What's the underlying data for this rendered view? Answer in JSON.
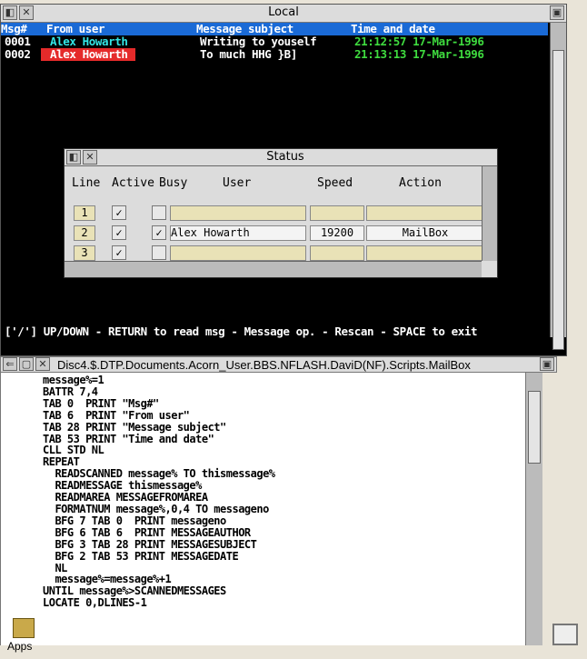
{
  "local": {
    "title": "Local",
    "headers": {
      "num": "Msg#",
      "user": "From user",
      "subject": "Message subject",
      "date": "Time and date"
    },
    "rows": [
      {
        "num": "0001",
        "user": "Alex Howarth",
        "subject": "Writing to youself",
        "date": "21:12:57 17-Mar-1996"
      },
      {
        "num": "0002",
        "user": "Alex Howarth",
        "subject": "To much HHG }B]",
        "date": "21:13:13 17-Mar-1996"
      }
    ],
    "status_line": "['/'] UP/DOWN - RETURN to read msg - Message op. - Rescan - SPACE to exit"
  },
  "status_dialog": {
    "title": "Status",
    "columns": {
      "line": "Line",
      "active": "Active",
      "busy": "Busy",
      "user": "User",
      "speed": "Speed",
      "action": "Action"
    },
    "rows": [
      {
        "line": "1",
        "active": "✓",
        "busy": "",
        "user": "",
        "speed": "",
        "action": ""
      },
      {
        "line": "2",
        "active": "✓",
        "busy": "✓",
        "user": "Alex Howarth",
        "speed": "19200",
        "action": "MailBox"
      },
      {
        "line": "3",
        "active": "✓",
        "busy": "",
        "user": "",
        "speed": "",
        "action": ""
      }
    ]
  },
  "editor": {
    "title": "Disc4.$.DTP.Documents.Acorn_User.BBS.NFLASH.DaviD(NF).Scripts.MailBox",
    "lines": [
      "message%=1",
      "BATTR 7,4",
      "TAB 0  PRINT \"Msg#\"",
      "TAB 6  PRINT \"From user\"",
      "TAB 28 PRINT \"Message subject\"",
      "TAB 53 PRINT \"Time and date\"",
      "CLL STD NL",
      "REPEAT",
      "  READSCANNED message% TO thismessage%",
      "  READMESSAGE thismessage%",
      "  READMAREA MESSAGEFROMAREA",
      "  FORMATNUM message%,0,4 TO messageno",
      "  BFG 7 TAB 0  PRINT messageno",
      "  BFG 6 TAB 6  PRINT MESSAGEAUTHOR",
      "  BFG 3 TAB 28 PRINT MESSAGESUBJECT",
      "  BFG 2 TAB 53 PRINT MESSAGEDATE",
      "  NL",
      "  message%=message%+1",
      "UNTIL message%>SCANNEDMESSAGES",
      "LOCATE 0,DLINES-1"
    ]
  },
  "apps": {
    "label": "Apps"
  },
  "colors": {
    "header_bg": "#1a6ad6",
    "selected_bg": "#e52a2a",
    "user": "#32e5e5",
    "date": "#3fdc3f",
    "input_cell": "#e9e2b7"
  }
}
